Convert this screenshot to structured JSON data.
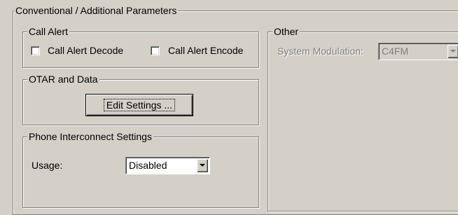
{
  "conventional": {
    "title": "Conventional / Additional Parameters"
  },
  "call_alert": {
    "title": "Call Alert",
    "decode_label": "Call Alert Decode",
    "decode_checked": false,
    "encode_label": "Call Alert Encode",
    "encode_checked": false
  },
  "otar": {
    "title": "OTAR and Data",
    "edit_settings_label": "Edit Settings ..."
  },
  "phone": {
    "title": "Phone Interconnect Settings",
    "usage_label": "Usage:",
    "usage_value": "Disabled"
  },
  "other": {
    "title": "Other",
    "system_modulation_label": "System Modulation:",
    "system_modulation_value": "C4FM"
  }
}
